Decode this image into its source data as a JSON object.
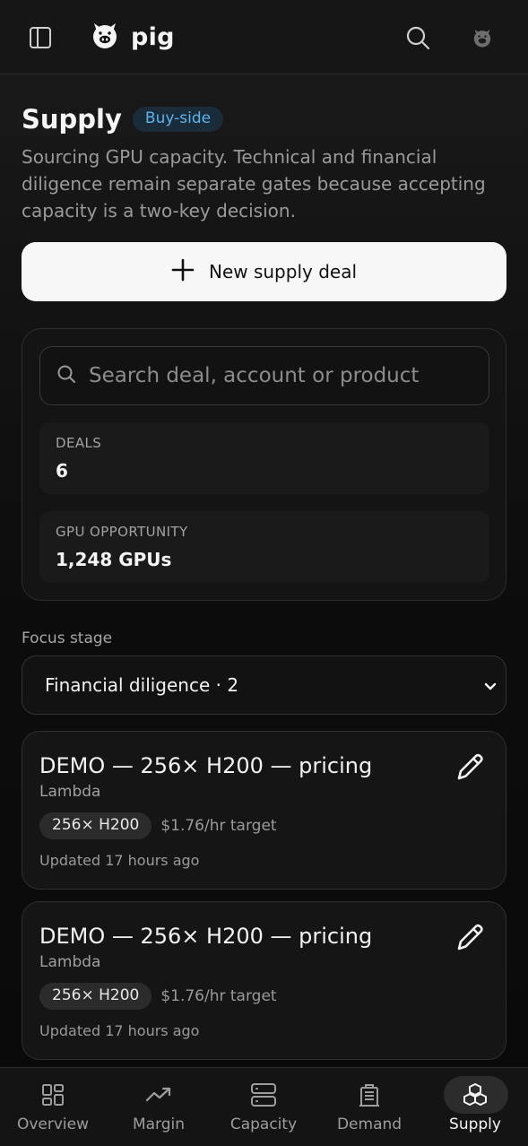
{
  "app": {
    "name": "pig"
  },
  "header": {
    "title": "Supply",
    "badge": "Buy-side"
  },
  "subtitle": "Sourcing GPU capacity. Technical and financial diligence remain separate gates because accepting capacity is a two-key decision.",
  "new_deal_button": {
    "label": "New supply deal"
  },
  "search": {
    "placeholder": "Search deal, account or product"
  },
  "stats": [
    {
      "label": "DEALS",
      "value": "6"
    },
    {
      "label": "GPU OPPORTUNITY",
      "value": "1,248 GPUs"
    }
  ],
  "focus_stage": {
    "label": "Focus stage",
    "value": "Financial diligence · 2"
  },
  "deals": [
    {
      "title": "DEMO — 256× H200 — pricing",
      "account": "Lambda",
      "chip": "256× H200",
      "price": "$1.76/hr target",
      "updated": "Updated 17 hours ago"
    },
    {
      "title": "DEMO — 256× H200 — pricing",
      "account": "Lambda",
      "chip": "256× H200",
      "price": "$1.76/hr target",
      "updated": "Updated 17 hours ago"
    }
  ],
  "nav": [
    {
      "label": "Overview",
      "icon": "grid-icon"
    },
    {
      "label": "Margin",
      "icon": "trending-up-icon"
    },
    {
      "label": "Capacity",
      "icon": "server-icon"
    },
    {
      "label": "Demand",
      "icon": "building-icon"
    },
    {
      "label": "Supply",
      "icon": "boxes-icon",
      "active": true
    }
  ],
  "colors": {
    "accent": "#5cb4ef",
    "background": "#0d0d0d",
    "button": "#f7f7f7"
  }
}
